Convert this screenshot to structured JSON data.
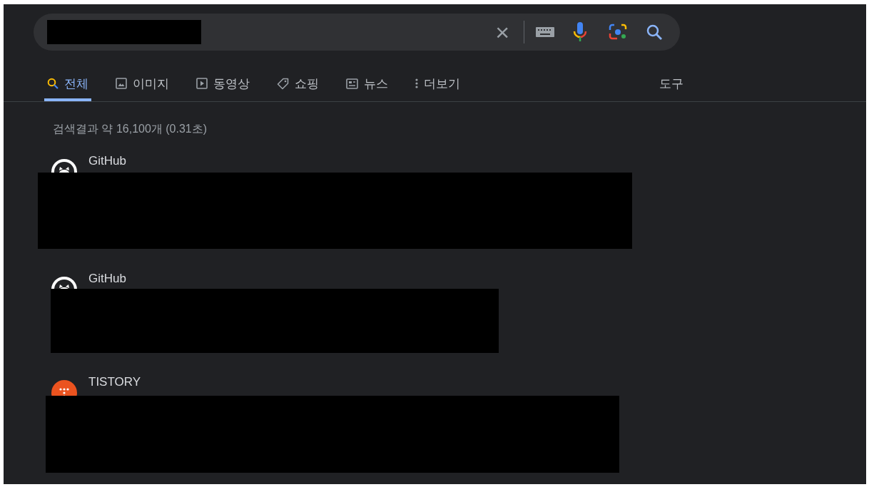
{
  "search": {
    "clear_label": "×"
  },
  "tabs": [
    {
      "label": "전체",
      "kind": "all",
      "selected": true
    },
    {
      "label": "이미지",
      "kind": "images",
      "selected": false
    },
    {
      "label": "동영상",
      "kind": "videos",
      "selected": false
    },
    {
      "label": "쇼핑",
      "kind": "shopping",
      "selected": false
    },
    {
      "label": "뉴스",
      "kind": "news",
      "selected": false
    },
    {
      "label": "더보기",
      "kind": "more",
      "selected": false
    }
  ],
  "tools": "도구",
  "result_stats": "검색결과 약 16,100개 (0.31초)",
  "results": [
    {
      "source": "GitHub",
      "kind": "github"
    },
    {
      "source": "GitHub",
      "kind": "github"
    },
    {
      "source": "TISTORY",
      "kind": "tistory"
    }
  ]
}
